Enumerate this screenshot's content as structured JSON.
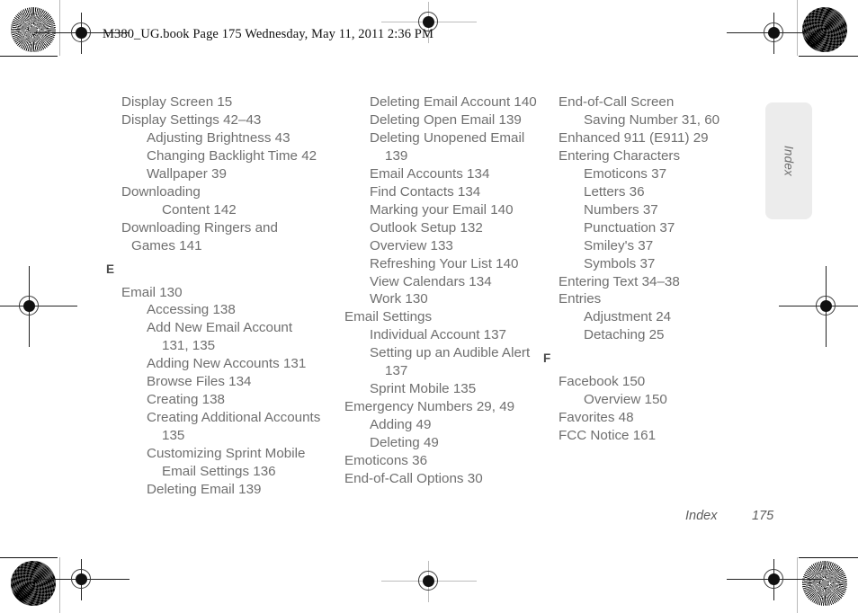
{
  "header": {
    "text": "M380_UG.book  Page 175  Wednesday, May 11, 2011  2:36 PM"
  },
  "side_tab": {
    "label": "Index"
  },
  "footer": {
    "section": "Index",
    "page_number": "175"
  },
  "colors": {
    "entry_text": "#6f6f6f",
    "section_letter": "#4a4a4a",
    "side_tab_background": "#ececec",
    "header_text": "#111111",
    "footer_text": "#5d5d5d"
  },
  "columns": [
    {
      "id": "column-1",
      "lines": [
        {
          "level": 0,
          "text": "Display Screen 15"
        },
        {
          "level": 0,
          "text": "Display Settings 42–43"
        },
        {
          "level": 1,
          "text": "Adjusting Brightness 43"
        },
        {
          "level": 1,
          "text": "Changing Backlight Time 42"
        },
        {
          "level": 1,
          "text": "Wallpaper 39"
        },
        {
          "level": 0,
          "text": "Downloading"
        },
        {
          "level": 2,
          "text": "Content 142"
        },
        {
          "level": 0,
          "text": "Downloading Ringers and"
        },
        {
          "level": 0,
          "wrap": true,
          "text": "Games 141"
        },
        {
          "level": "letter",
          "text": "E"
        },
        {
          "level": 0,
          "text": "Email 130"
        },
        {
          "level": 1,
          "text": "Accessing 138"
        },
        {
          "level": 1,
          "text": "Add New Email Account"
        },
        {
          "level": 2,
          "text": "131, 135"
        },
        {
          "level": 1,
          "text": "Adding New Accounts 131"
        },
        {
          "level": 1,
          "text": "Browse Files 134"
        },
        {
          "level": 1,
          "text": "Creating 138"
        },
        {
          "level": 1,
          "text": "Creating Additional Accounts"
        },
        {
          "level": 2,
          "text": "135"
        },
        {
          "level": 1,
          "text": "Customizing Sprint Mobile"
        },
        {
          "level": 2,
          "text": "Email Settings 136"
        },
        {
          "level": 1,
          "text": "Deleting Email 139"
        }
      ]
    },
    {
      "id": "column-2",
      "lines": [
        {
          "level": 1,
          "text": "Deleting Email Account 140"
        },
        {
          "level": 1,
          "text": "Deleting Open Email 139"
        },
        {
          "level": 1,
          "text": "Deleting Unopened Email"
        },
        {
          "level": 2,
          "text": "139"
        },
        {
          "level": 1,
          "text": "Email Accounts 134"
        },
        {
          "level": 1,
          "text": "Find Contacts 134"
        },
        {
          "level": 1,
          "text": "Marking your Email 140"
        },
        {
          "level": 1,
          "text": "Outlook Setup 132"
        },
        {
          "level": 1,
          "text": "Overview 133"
        },
        {
          "level": 1,
          "text": "Refreshing Your List 140"
        },
        {
          "level": 1,
          "text": "View Calendars 134"
        },
        {
          "level": 1,
          "text": "Work 130"
        },
        {
          "level": 0,
          "text": "Email Settings"
        },
        {
          "level": 1,
          "text": "Individual Account 137"
        },
        {
          "level": 1,
          "text": "Setting up an Audible Alert"
        },
        {
          "level": 2,
          "text": "137"
        },
        {
          "level": 1,
          "text": "Sprint Mobile 135"
        },
        {
          "level": 0,
          "text": "Emergency Numbers 29, 49"
        },
        {
          "level": 1,
          "text": "Adding 49"
        },
        {
          "level": 1,
          "text": "Deleting 49"
        },
        {
          "level": 0,
          "text": "Emoticons 36"
        },
        {
          "level": 0,
          "text": "End-of-Call Options 30"
        }
      ]
    },
    {
      "id": "column-3",
      "lines": [
        {
          "level": 0,
          "text": "End-of-Call Screen"
        },
        {
          "level": 1,
          "text": "Saving Number 31, 60"
        },
        {
          "level": 0,
          "text": "Enhanced 911 (E911) 29"
        },
        {
          "level": 0,
          "text": "Entering Characters"
        },
        {
          "level": 1,
          "text": "Emoticons 37"
        },
        {
          "level": 1,
          "text": "Letters 36"
        },
        {
          "level": 1,
          "text": "Numbers 37"
        },
        {
          "level": 1,
          "text": "Punctuation 37"
        },
        {
          "level": 1,
          "text": "Smiley's 37"
        },
        {
          "level": 1,
          "text": "Symbols 37"
        },
        {
          "level": 0,
          "text": "Entering Text 34–38"
        },
        {
          "level": 0,
          "text": "Entries"
        },
        {
          "level": 1,
          "text": "Adjustment 24"
        },
        {
          "level": 1,
          "text": "Detaching 25"
        },
        {
          "level": "letter",
          "text": "F"
        },
        {
          "level": 0,
          "text": "Facebook 150"
        },
        {
          "level": 1,
          "text": "Overview 150"
        },
        {
          "level": 0,
          "text": "Favorites 48"
        },
        {
          "level": 0,
          "text": "FCC Notice 161"
        }
      ]
    }
  ],
  "print_marks": {
    "top_left_target": "starburst-calibration-target",
    "top_right_target": "maze-calibration-target",
    "bottom_left_target": "maze-calibration-target",
    "bottom_right_target": "starburst-calibration-target",
    "registration_marks": "crosshair-registration-mark"
  }
}
